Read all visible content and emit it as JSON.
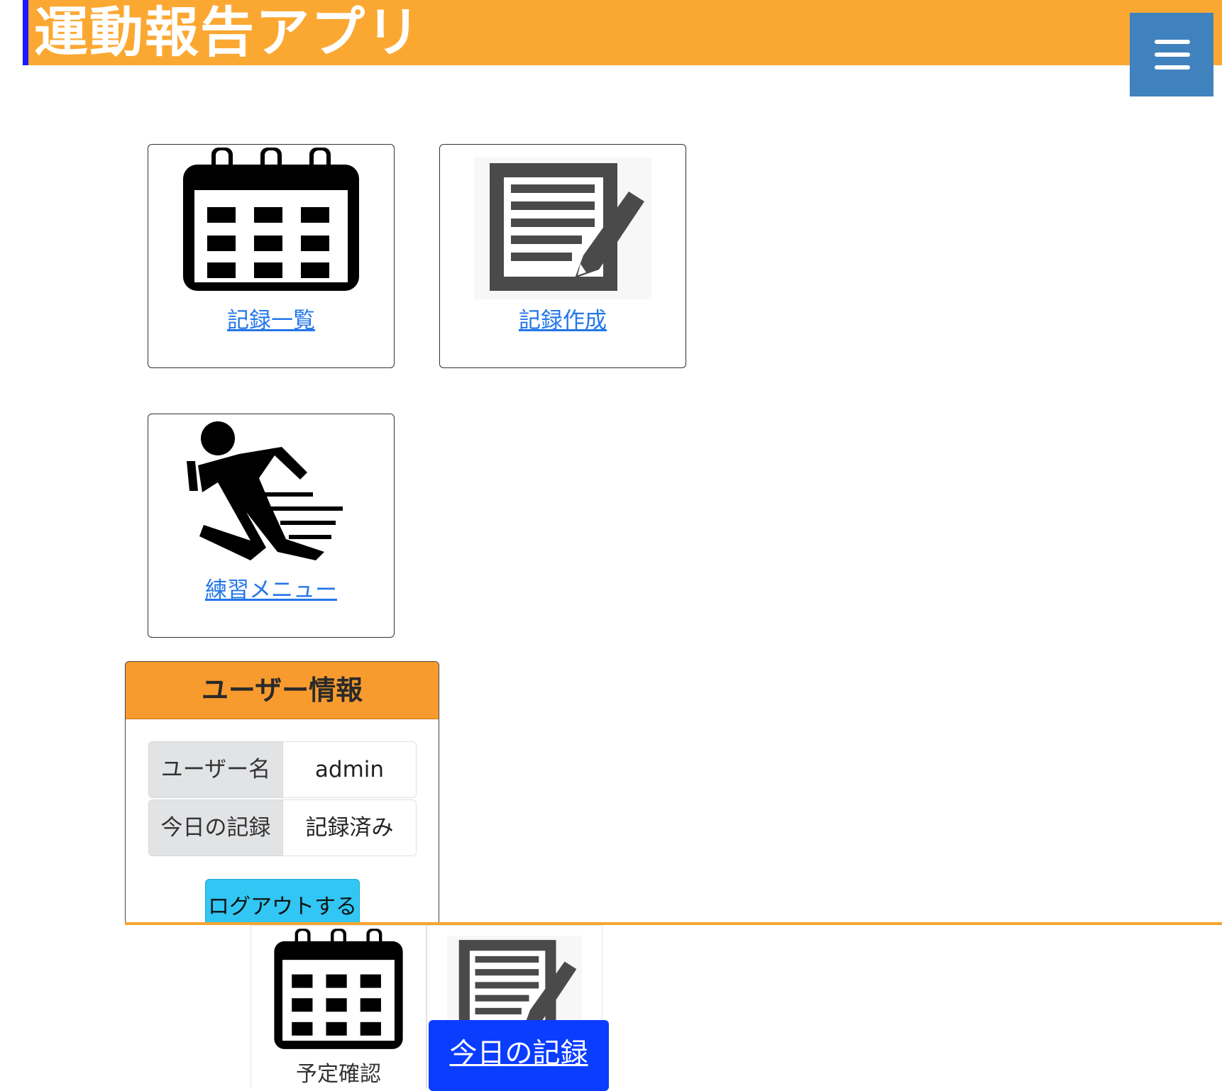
{
  "header": {
    "title": "運動報告アプリ",
    "menu_icon": "hamburger-menu-icon"
  },
  "cards": [
    {
      "icon": "calendar-icon",
      "label": "記録一覧"
    },
    {
      "icon": "note-edit-icon",
      "label": "記録作成"
    },
    {
      "icon": "running-person-icon",
      "label": "練習メニュー"
    }
  ],
  "user_panel": {
    "title": "ユーザー情報",
    "rows": [
      {
        "label": "ユーザー名",
        "value": "admin"
      },
      {
        "label": "今日の記録",
        "value": "記録済み"
      }
    ],
    "logout_label": "ログアウトする"
  },
  "footer": {
    "schedule_label": "予定確認",
    "schedule_icon": "calendar-icon",
    "record_icon": "note-edit-icon",
    "today_label": "今日の記録"
  },
  "colors": {
    "header_bg": "#fba833",
    "header_accent": "#1a1aff",
    "menu_button": "#4082be",
    "panel_header": "#f89b2e",
    "logout_button": "#31c6f3",
    "link": "#2477ea",
    "today_button": "#0b3dff"
  }
}
